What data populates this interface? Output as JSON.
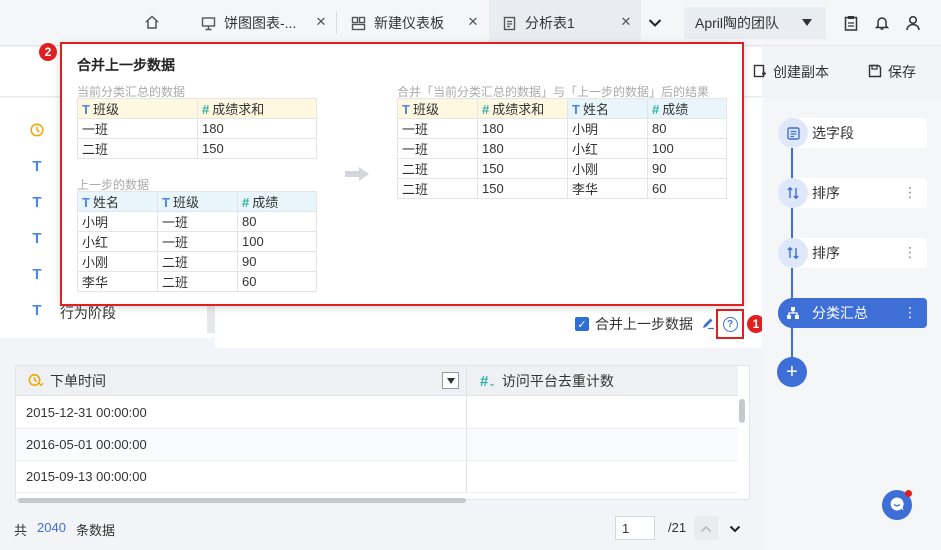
{
  "tabs": {
    "home_icon": "home-icon",
    "items": [
      {
        "label": "饼图图表-...",
        "icon": "dashboard-icon",
        "active": false
      },
      {
        "label": "新建仪表板",
        "icon": "layout-icon",
        "active": false
      },
      {
        "label": "分析表1",
        "icon": "doc-icon",
        "active": true
      }
    ],
    "close_glyph": "✕",
    "team": "April陶的团队"
  },
  "toolbar": {
    "copy_label": "创建副本",
    "save_label": "保存"
  },
  "fields": [
    {
      "type": "date",
      "label": ""
    },
    {
      "type": "text",
      "label": ""
    },
    {
      "type": "text",
      "label": ""
    },
    {
      "type": "text",
      "label": ""
    },
    {
      "type": "text",
      "label": ""
    },
    {
      "type": "text",
      "label": "行为阶段"
    }
  ],
  "merge": {
    "label": "合并上一步数据",
    "checked": true
  },
  "badges": {
    "one": "1",
    "two": "2"
  },
  "popover": {
    "title": "合并上一步数据",
    "current_caption": "当前分类汇总的数据",
    "current_headers": [
      "班级",
      "成绩求和"
    ],
    "current_rows": [
      [
        "一班",
        "180"
      ],
      [
        "二班",
        "150"
      ]
    ],
    "prev_caption": "上一步的数据",
    "prev_headers": [
      "姓名",
      "班级",
      "成绩"
    ],
    "prev_rows": [
      [
        "小明",
        "一班",
        "80"
      ],
      [
        "小红",
        "一班",
        "100"
      ],
      [
        "小刚",
        "二班",
        "90"
      ],
      [
        "李华",
        "二班",
        "60"
      ]
    ],
    "result_caption": "合并「当前分类汇总的数据」与「上一步的数据」后的结果",
    "result_headers": [
      "班级",
      "成绩求和",
      "姓名",
      "成绩"
    ],
    "result_rows": [
      [
        "一班",
        "180",
        "小明",
        "80"
      ],
      [
        "一班",
        "180",
        "小红",
        "100"
      ],
      [
        "二班",
        "150",
        "小刚",
        "90"
      ],
      [
        "二班",
        "150",
        "李华",
        "60"
      ]
    ]
  },
  "preview": {
    "columns": [
      "下单时间",
      "访问平台去重计数"
    ],
    "rows": [
      "2015-12-31 00:00:00",
      "2016-05-01 00:00:00",
      "2015-09-13 00:00:00"
    ],
    "total_prefix": "共",
    "total_count": "2040",
    "total_suffix": "条数据",
    "page": "1",
    "page_total": "/21"
  },
  "pipeline": [
    {
      "label": "选字段",
      "icon": "select-fields-icon",
      "active": false,
      "more": false
    },
    {
      "label": "排序",
      "icon": "sort-icon",
      "active": false,
      "more": true
    },
    {
      "label": "排序",
      "icon": "sort-icon",
      "active": false,
      "more": true
    },
    {
      "label": "分类汇总",
      "icon": "group-summary-icon",
      "active": true,
      "more": true
    }
  ],
  "colors": {
    "accent": "#3d6fd6",
    "highlight": "#e02020"
  }
}
